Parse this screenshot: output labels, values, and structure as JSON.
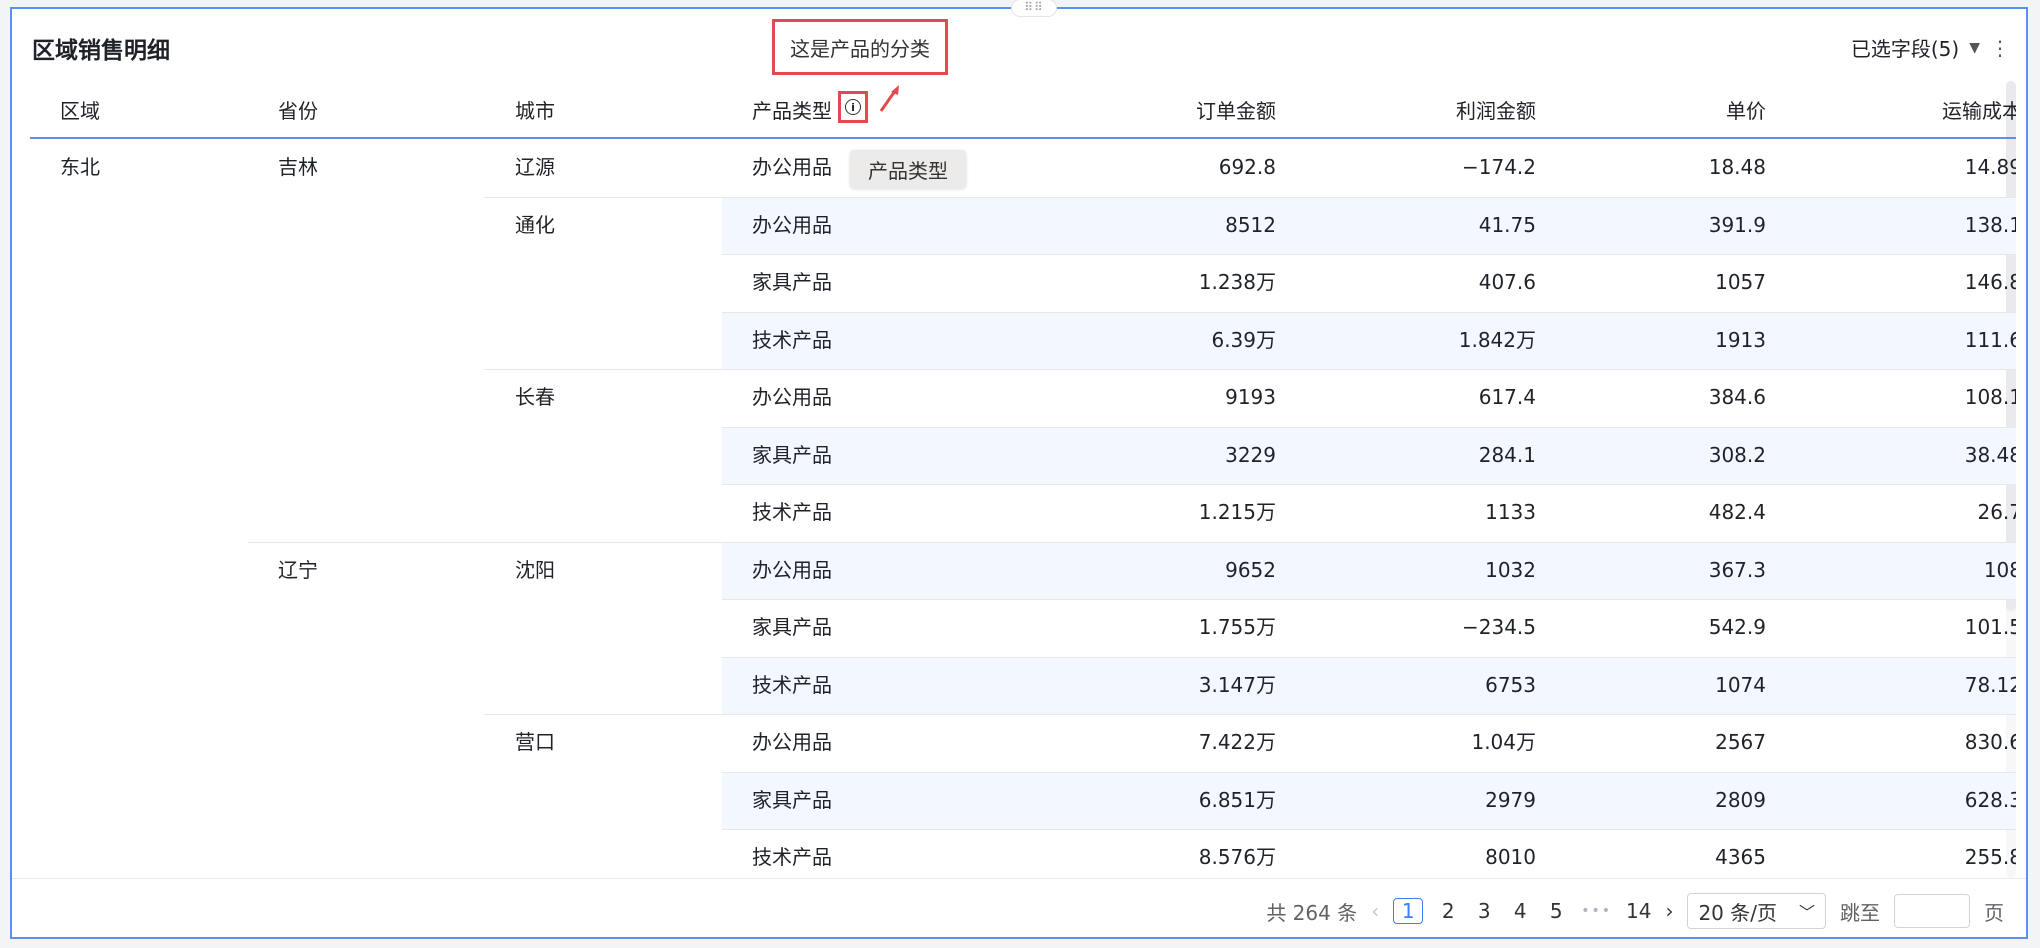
{
  "title": "区域销售明细",
  "fields_selector": {
    "label": "已选字段(5)"
  },
  "callout_text": "这是产品的分类",
  "tooltip_text": "产品类型",
  "columns": [
    "区域",
    "省份",
    "城市",
    "产品类型",
    "订单金额",
    "利润金额",
    "单价",
    "运输成本"
  ],
  "rows": [
    {
      "region": "东北",
      "province": "吉林",
      "city": "辽源",
      "category": "办公用品",
      "order": "692.8",
      "profit": "−174.2",
      "price": "18.48",
      "shipping": "14.89"
    },
    {
      "region": "",
      "province": "",
      "city": "通化",
      "category": "办公用品",
      "order": "8512",
      "profit": "41.75",
      "price": "391.9",
      "shipping": "138.1"
    },
    {
      "region": "",
      "province": "",
      "city": "",
      "category": "家具产品",
      "order": "1.238万",
      "profit": "407.6",
      "price": "1057",
      "shipping": "146.8"
    },
    {
      "region": "",
      "province": "",
      "city": "",
      "category": "技术产品",
      "order": "6.39万",
      "profit": "1.842万",
      "price": "1913",
      "shipping": "111.6"
    },
    {
      "region": "",
      "province": "",
      "city": "长春",
      "category": "办公用品",
      "order": "9193",
      "profit": "617.4",
      "price": "384.6",
      "shipping": "108.1"
    },
    {
      "region": "",
      "province": "",
      "city": "",
      "category": "家具产品",
      "order": "3229",
      "profit": "284.1",
      "price": "308.2",
      "shipping": "38.48"
    },
    {
      "region": "",
      "province": "",
      "city": "",
      "category": "技术产品",
      "order": "1.215万",
      "profit": "1133",
      "price": "482.4",
      "shipping": "26.7"
    },
    {
      "region": "",
      "province": "辽宁",
      "city": "沈阳",
      "category": "办公用品",
      "order": "9652",
      "profit": "1032",
      "price": "367.3",
      "shipping": "108"
    },
    {
      "region": "",
      "province": "",
      "city": "",
      "category": "家具产品",
      "order": "1.755万",
      "profit": "−234.5",
      "price": "542.9",
      "shipping": "101.5"
    },
    {
      "region": "",
      "province": "",
      "city": "",
      "category": "技术产品",
      "order": "3.147万",
      "profit": "6753",
      "price": "1074",
      "shipping": "78.12"
    },
    {
      "region": "",
      "province": "",
      "city": "营口",
      "category": "办公用品",
      "order": "7.422万",
      "profit": "1.04万",
      "price": "2567",
      "shipping": "830.6"
    },
    {
      "region": "",
      "province": "",
      "city": "",
      "category": "家具产品",
      "order": "6.851万",
      "profit": "2979",
      "price": "2809",
      "shipping": "628.3"
    },
    {
      "region": "",
      "province": "",
      "city": "",
      "category": "技术产品",
      "order": "8.576万",
      "profit": "8010",
      "price": "4365",
      "shipping": "255.8"
    }
  ],
  "pagination": {
    "total_text": "共 264 条",
    "pages": [
      "1",
      "2",
      "3",
      "4",
      "5"
    ],
    "ellipsis": "•••",
    "last_page": "14",
    "current_page": "1",
    "page_size": "20 条/页",
    "goto_label": "跳至",
    "goto_suffix": "页",
    "goto_value": ""
  },
  "icons": {
    "info": "info-icon",
    "caret": "caret-down-icon",
    "more": "more-vertical-icon",
    "prev": "chevron-left-icon",
    "next": "chevron-right-icon",
    "select_arrow": "chevron-down-icon",
    "drag": "drag-handle-icon"
  },
  "colors": {
    "accent": "#5b8ff0",
    "annotation": "#e5484d",
    "band": "#f3f7fe",
    "page_active": "#3b7ff0"
  }
}
